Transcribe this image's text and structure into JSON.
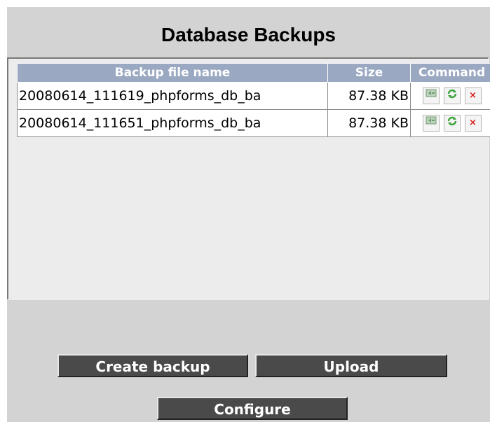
{
  "title": "Database Backups",
  "table": {
    "columns": [
      "Backup file name",
      "Size",
      "Command"
    ],
    "rows": [
      {
        "name": "20080614_111619_phpforms_db_ba",
        "size": "87.38 KB"
      },
      {
        "name": "20080614_111651_phpforms_db_ba",
        "size": "87.38 KB"
      }
    ],
    "commands": {
      "restore_icon": "restore-icon",
      "refresh_icon": "refresh-icon",
      "delete_icon": "delete-icon",
      "delete_glyph": "×"
    }
  },
  "buttons": {
    "create": "Create backup",
    "upload": "Upload",
    "configure": "Configure"
  },
  "colors": {
    "header_bg": "#9aa8c2",
    "button_bg": "#4a4a4a",
    "panel_bg": "#d3d3d3"
  }
}
